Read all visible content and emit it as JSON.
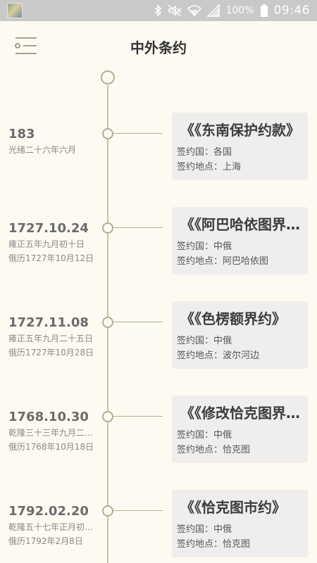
{
  "status_bar": {
    "battery": "100%",
    "time": "09:46",
    "icons": [
      "app-thumbnail-icon",
      "bluetooth-icon",
      "mute-icon",
      "wifi-icon",
      "signal-icon",
      "battery-icon"
    ]
  },
  "header": {
    "title": "中外条约",
    "menu_icon": "menu-list-icon"
  },
  "treaties": [
    {
      "date": "183",
      "sub1": "光绪二十六年六月",
      "sub2": "",
      "title": "《《东南保护约款》",
      "country": "签约国：各国",
      "place": "签约地点：上海"
    },
    {
      "date": "1727.10.24",
      "sub1": "雍正五年九月初十日",
      "sub2": "俄历1727年10月12日",
      "title": "《《阿巴哈依图界约》",
      "country": "签约国：中俄",
      "place": "签约地点：阿巴哈依图"
    },
    {
      "date": "1727.11.08",
      "sub1": "雍正五年九月二十五日",
      "sub2": "俄历1727年10月28日",
      "title": "《《色楞额界约》",
      "country": "签约国：中俄",
      "place": "签约地点：波尔河边"
    },
    {
      "date": "1768.10.30",
      "sub1": "乾隆三十三年九月二十日",
      "sub2": "俄历1768年10月18日",
      "title": "《《修改恰克图界约》",
      "country": "签约国：中俄",
      "place": "签约地点：恰克图"
    },
    {
      "date": "1792.02.20",
      "sub1": "乾隆五十七年正月初八日",
      "sub2": "俄历1792年2月8日",
      "title": "《《恰克图市约》",
      "country": "签约国：中俄",
      "place": "签约地点：恰克图"
    }
  ]
}
